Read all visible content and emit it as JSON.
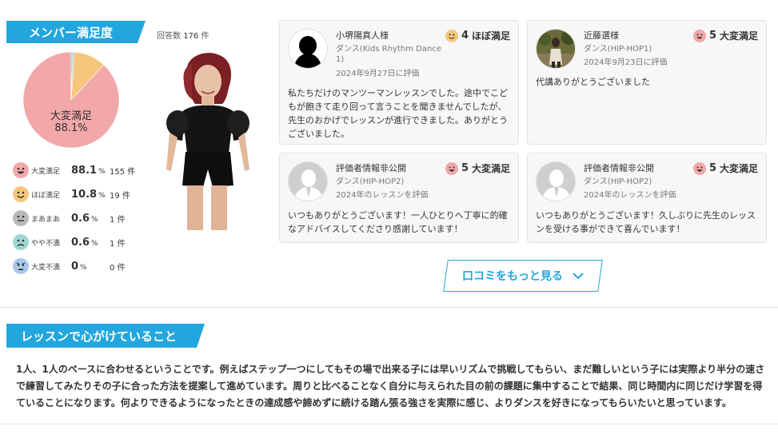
{
  "satisfaction": {
    "title": "メンバー満足度",
    "response_count_label": "回答数",
    "response_count": "176",
    "response_count_unit": "件",
    "pie_label": "大変満足",
    "pie_value": "88.1%",
    "distribution": [
      {
        "label": "大変満足",
        "pct": "88.1",
        "count": "155",
        "share": 0.881,
        "color": "#f2a7a9",
        "face": "very-satisfied-face-icon"
      },
      {
        "label": "ほぼ満足",
        "pct": "10.8",
        "count": "19",
        "share": 0.108,
        "color": "#f4c77c",
        "face": "satisfied-face-icon"
      },
      {
        "label": "まあまあ",
        "pct": "0.6",
        "count": "1",
        "share": 0.006,
        "color": "#b9b9b9",
        "face": "neutral-face-icon"
      },
      {
        "label": "やや不満",
        "pct": "0.6",
        "count": "1",
        "share": 0.006,
        "color": "#9ed7d0",
        "face": "dissatisfied-face-icon"
      },
      {
        "label": "大変不満",
        "pct": "0",
        "count": "0",
        "share": 0.0,
        "color": "#a9c7ec",
        "face": "very-dissatisfied-face-icon"
      }
    ],
    "pct_unit": "%",
    "count_unit": "件"
  },
  "reviews": [
    {
      "name": "小堺陽真人様",
      "rating": "4",
      "rating_label": "ほぼ満足",
      "genre": "ダンス(Kids Rhythm Dance 1)",
      "date": "2024年9月27日に評価",
      "comment": "私たちだけのマンツーマンレッスンでした。途中でこどもが飽きて走り回って言うことを聞きませんでしたが、先生のおかげでレッスンが進行できました。ありがとうございました。"
    },
    {
      "name": "近藤選様",
      "rating": "5",
      "rating_label": "大変満足",
      "genre": "ダンス(HIP-HOP1)",
      "date": "2024年9月23日に評価",
      "comment": "代講ありがとうございました"
    },
    {
      "name": "評価者情報非公開",
      "rating": "5",
      "rating_label": "大変満足",
      "genre": "ダンス(HIP-HOP2)",
      "date": "2024年のレッスンを評価",
      "comment": "いつもありがとうございます！一人ひとりへ丁寧に的確なアドバイスしてくださり感謝しています！"
    },
    {
      "name": "評価者情報非公開",
      "rating": "5",
      "rating_label": "大変満足",
      "genre": "ダンス(HIP-HOP2)",
      "date": "2024年のレッスンを評価",
      "comment": "いつもありがとうございます！久しぶりに先生のレッスンを受ける事ができて喜んでいます！"
    }
  ],
  "more_button": "口コミをもっと見る",
  "lesson": {
    "title": "レッスンで心がけていること",
    "body": "1人、1人のペースに合わせるということです。例えばステップ一つにしてもその場で出来る子には早いリズムで挑戦してもらい、まだ難しいという子には実際より半分の速さで練習してみたりその子に合った方法を提案して進めています。周りと比べることなく自分に与えられた目の前の課題に集中することで結果、同じ時間内に同じだけ学習を得ていることになります。何よりできるようになったときの達成感や諦めずに続ける踏ん張る強さを実際に感じ、よりダンスを好きになってもらいたいと思っています。"
  }
}
